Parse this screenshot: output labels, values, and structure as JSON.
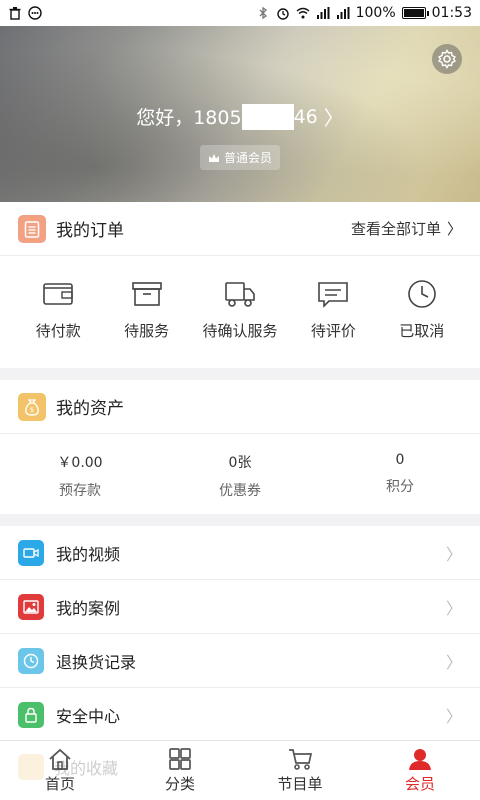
{
  "status_bar": {
    "battery": "100%",
    "time": "01:53",
    "battery_level": 1.0
  },
  "header": {
    "greeting_prefix": "您好，1805",
    "greeting_suffix": "46",
    "member_level": "普通会员"
  },
  "orders": {
    "title": "我的订单",
    "view_all": "查看全部订单",
    "items": [
      {
        "label": "待付款",
        "icon": "wallet-icon"
      },
      {
        "label": "待服务",
        "icon": "box-icon"
      },
      {
        "label": "待确认服务",
        "icon": "truck-icon"
      },
      {
        "label": "待评价",
        "icon": "comment-icon"
      },
      {
        "label": "已取消",
        "icon": "clock-icon"
      }
    ]
  },
  "assets": {
    "title": "我的资产",
    "items": [
      {
        "value": "￥0.00",
        "label": "预存款"
      },
      {
        "value": "0张",
        "label": "优惠券"
      },
      {
        "value": "0",
        "label": "积分"
      }
    ]
  },
  "menu": {
    "items": [
      {
        "label": "我的视频",
        "icon": "video-icon",
        "color": "#2aa8e8"
      },
      {
        "label": "我的案例",
        "icon": "image-icon",
        "color": "#e03a3a"
      },
      {
        "label": "退换货记录",
        "icon": "clock-icon",
        "color": "#6cc6ea"
      },
      {
        "label": "安全中心",
        "icon": "lock-icon",
        "color": "#4cbf6b"
      }
    ],
    "ghost_item": "我的收藏"
  },
  "tabs": [
    {
      "label": "首页",
      "icon": "home-icon"
    },
    {
      "label": "分类",
      "icon": "grid-icon"
    },
    {
      "label": "节目单",
      "icon": "cart-icon"
    },
    {
      "label": "会员",
      "icon": "user-icon",
      "active": true
    }
  ],
  "colors": {
    "accent": "#e02a2a",
    "order_icon_bg": "#f2a183",
    "asset_icon_bg": "#f3c36a"
  }
}
